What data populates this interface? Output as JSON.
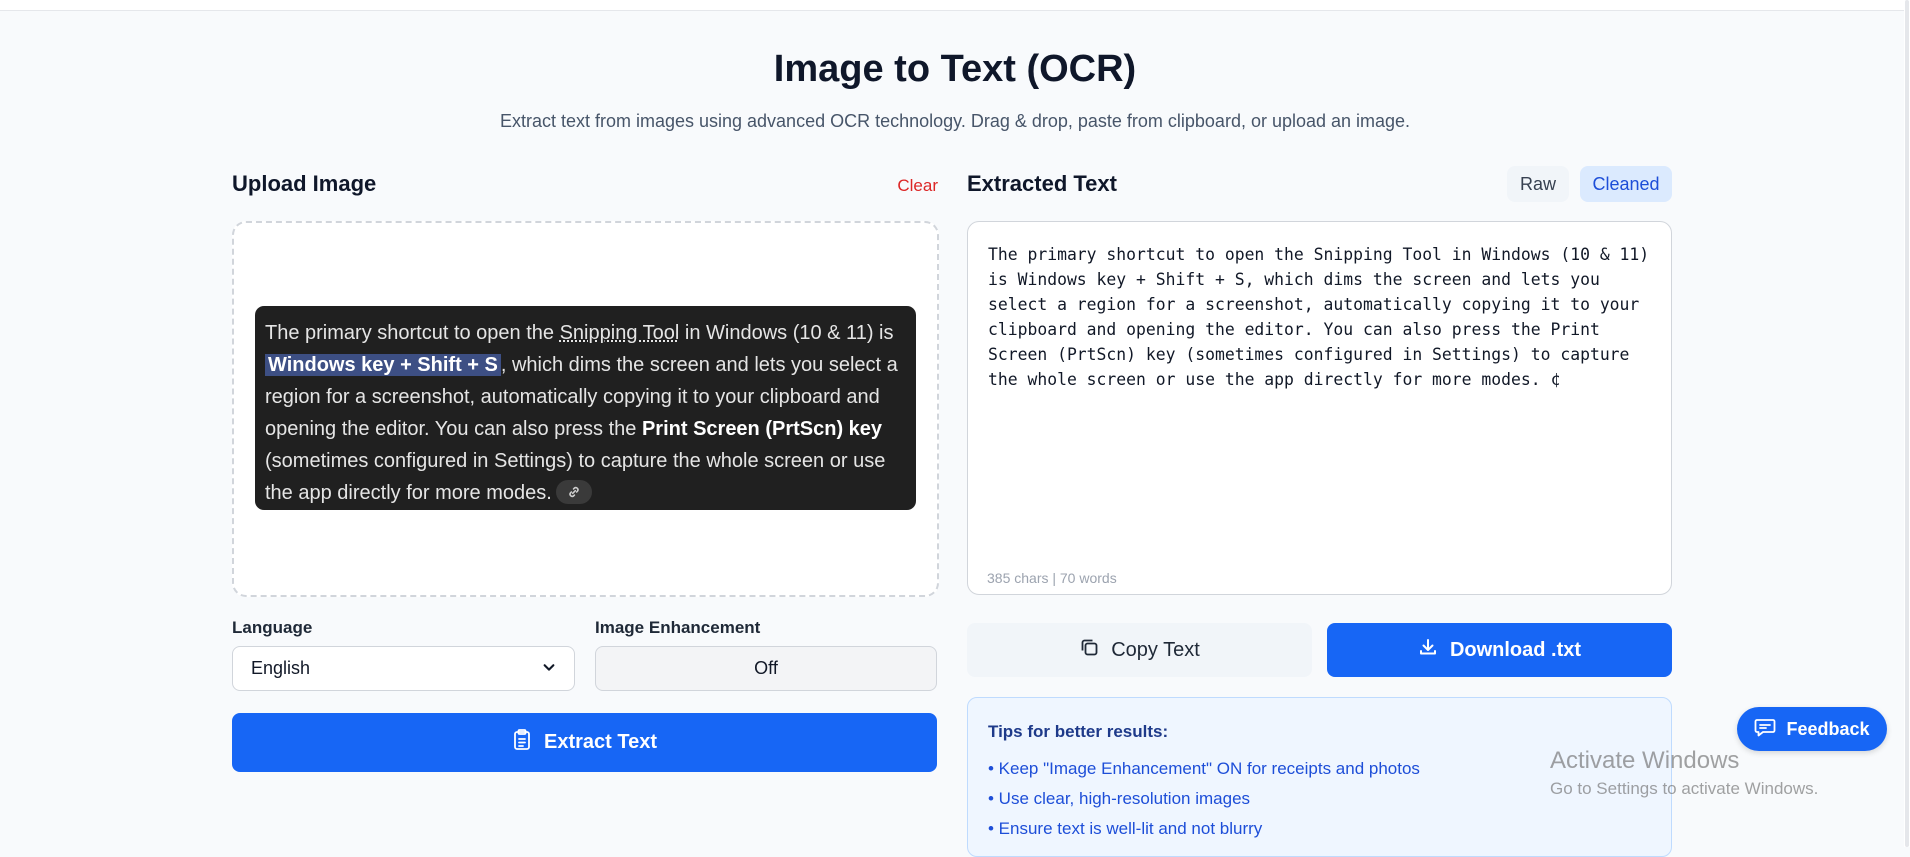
{
  "page": {
    "title": "Image to Text (OCR)",
    "subtitle": "Extract text from images using advanced OCR technology. Drag & drop, paste from clipboard, or upload an image."
  },
  "upload": {
    "heading": "Upload Image",
    "clear_label": "Clear",
    "preview": {
      "p1": "The primary shortcut to open the ",
      "p2_link": "Snipping Tool",
      "p3": " in Windows (10 & 11) is ",
      "p4_highlight": "Windows key + Shift + S",
      "p5": ", which dims the screen and lets you select a region for a screenshot, automatically copying it to your clipboard and opening the editor. You can also press the ",
      "p6_bold": "Print Screen (PrtScn) key",
      "p7": " (sometimes configured in Settings) to capture the whole screen or use the app directly for more modes."
    }
  },
  "options": {
    "language_label": "Language",
    "language_value": "English",
    "enhancement_label": "Image Enhancement",
    "enhancement_value": "Off"
  },
  "extract_label": "Extract Text",
  "output": {
    "heading": "Extracted Text",
    "raw_label": "Raw",
    "cleaned_label": "Cleaned",
    "text": "The primary shortcut to open the Snipping Tool in Windows (10 & 11)\nis Windows key + Shift + S, which dims the screen and lets you\nselect a region for a screenshot, automatically copying it to your\nclipboard and opening the editor. You can also press the Print\nScreen (PrtScn) key (sometimes configured in Settings) to capture\nthe whole screen or use the app directly for more modes. ¢",
    "counter": "385 chars | 70 words",
    "copy_label": "Copy Text",
    "download_label": "Download .txt"
  },
  "tips": {
    "title": "Tips for better results:",
    "items": [
      "• Keep \"Image Enhancement\" ON for receipts and photos",
      "• Use clear, high-resolution images",
      "• Ensure text is well-lit and not blurry"
    ]
  },
  "feedback_label": "Feedback",
  "watermark": {
    "line1": "Activate Windows",
    "line2": "Go to Settings to activate Windows."
  },
  "colors": {
    "primary": "#1766f5",
    "danger": "#dc2626",
    "tips_bg": "#eff6ff"
  },
  "icons": {
    "extract": "clipboard-icon",
    "copy": "copy-icon",
    "download": "download-icon",
    "feedback": "chat-icon",
    "preview_link": "link-icon",
    "select": "chevron-down-icon"
  }
}
